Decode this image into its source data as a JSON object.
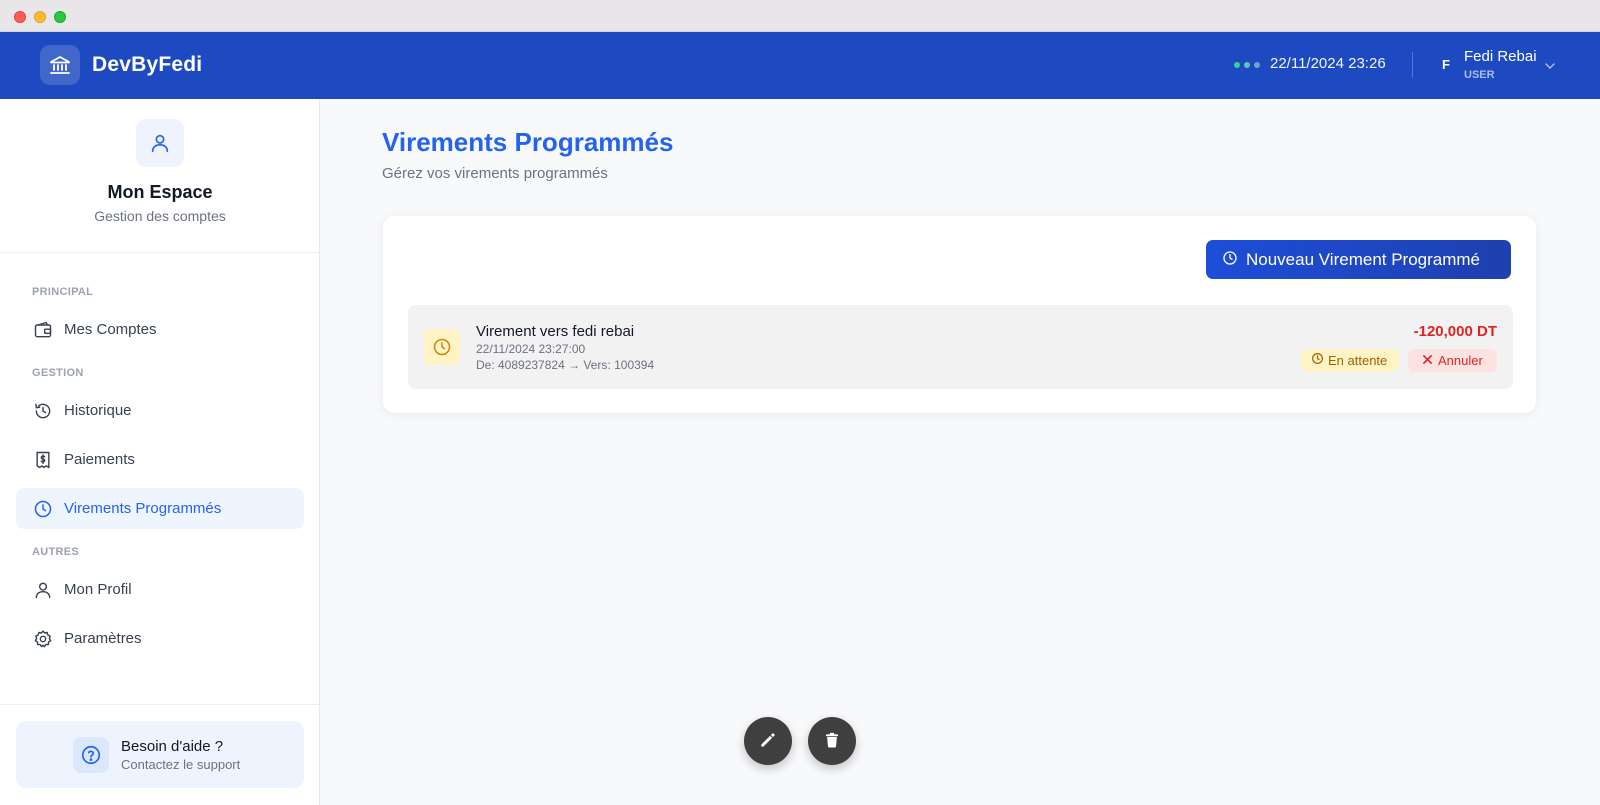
{
  "brand": {
    "name": "DevByFedi",
    "icon": "bank-icon"
  },
  "header": {
    "datetime": "22/11/2024 23:26",
    "user_initial": "F",
    "user_name": "Fedi Rebai",
    "user_role": "USER"
  },
  "sidebar": {
    "title": "Mon Espace",
    "subtitle": "Gestion des comptes",
    "sections": [
      "PRINCIPAL",
      "GESTION",
      "AUTRES"
    ],
    "items": [
      {
        "label": "Mes Comptes",
        "icon": "wallet-icon"
      },
      {
        "label": "Historique",
        "icon": "history-icon"
      },
      {
        "label": "Paiements",
        "icon": "receipt-icon"
      },
      {
        "label": "Virements Programmés",
        "icon": "clock-icon",
        "active": true
      },
      {
        "label": "Mon Profil",
        "icon": "user-icon"
      },
      {
        "label": "Paramètres",
        "icon": "gear-icon"
      }
    ],
    "help": {
      "title": "Besoin d'aide ?",
      "subtitle": "Contactez le support"
    }
  },
  "main": {
    "title": "Virements Programmés",
    "subtitle": "Gérez vos virements programmés",
    "new_button": "Nouveau Virement Programmé",
    "transfers": [
      {
        "title": "Virement vers fedi rebai",
        "date": "22/11/2024 23:27:00",
        "accounts": "De: 4089237824 → Vers: 100394",
        "amount": "-120,000 DT",
        "status": "En attente",
        "cancel_label": "Annuler"
      }
    ]
  },
  "colors": {
    "header": "#1d4ac0",
    "accent": "#2563eb",
    "danger": "#dc2626",
    "pending": "#a16207"
  }
}
